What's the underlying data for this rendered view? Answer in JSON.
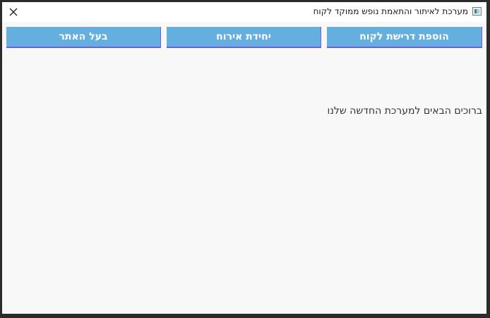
{
  "window": {
    "title": "מערכת לאיתור והתאמת נופש ממוקד לקוח",
    "icons": {
      "app": "app-window-icon",
      "close": "close-icon"
    }
  },
  "nav": {
    "buttons": [
      {
        "label": "הוספת דרישת לקוח"
      },
      {
        "label": "יחידת אירוח"
      },
      {
        "label": "בעל האתר"
      }
    ]
  },
  "main": {
    "welcome_text": "ברוכים הבאים למערכת החדשה שלנו"
  },
  "colors": {
    "button_bg": "#64afdf",
    "button_border": "#7a5ad8",
    "window_bg": "#f8f8f8",
    "frame": "#2b2b2b"
  }
}
